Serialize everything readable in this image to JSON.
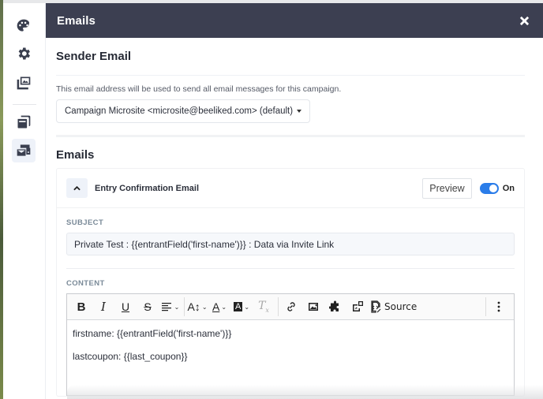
{
  "panel": {
    "title": "Emails",
    "close_icon": "close-icon"
  },
  "sidebar": {
    "items": [
      {
        "name": "palette",
        "icon": "palette-icon",
        "active": false
      },
      {
        "name": "settings",
        "icon": "gear-icon",
        "active": false
      },
      {
        "name": "images",
        "icon": "images-icon",
        "active": false
      },
      {
        "name": "pages",
        "icon": "windows-icon",
        "active": false
      },
      {
        "name": "emails",
        "icon": "email-stack-icon",
        "active": true
      }
    ]
  },
  "sender": {
    "title": "Sender Email",
    "help": "This email address will be used to send all email messages for this campaign.",
    "selected": "Campaign Microsite <microsite@beeliked.com> (default)"
  },
  "emails": {
    "title": "Emails",
    "card": {
      "title": "Entry Confirmation Email",
      "preview_label": "Preview",
      "toggle_on": true,
      "toggle_label": "On",
      "subject_label": "SUBJECT",
      "subject_value": "Private Test : {{entrantField('first-name')}} : Data via Invite Link",
      "content_label": "CONTENT",
      "toolbar": {
        "source_label": "Source",
        "tools": [
          "bold",
          "italic",
          "underline",
          "strikethrough",
          "align",
          "font-size",
          "text-color",
          "background-color",
          "remove-format",
          "link",
          "image",
          "plugin",
          "embed",
          "source",
          "more"
        ]
      },
      "body_lines": [
        "firstname: {{entrantField('first-name')}}",
        "lastcoupon: {{last_coupon}}"
      ]
    }
  },
  "colors": {
    "header_bg": "#3c3f51",
    "toggle_accent": "#2b7de9",
    "label_gray": "#7a8a98"
  }
}
